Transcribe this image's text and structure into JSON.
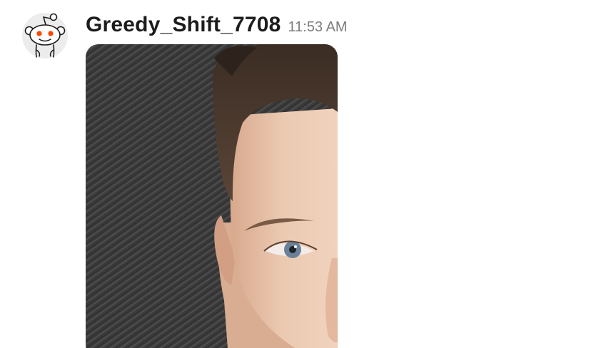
{
  "message": {
    "username": "Greedy_Shift_7708",
    "timestamp": "11:53 AM",
    "avatar_icon": "snoo-avatar-icon",
    "attachment": {
      "type": "image",
      "subject": "photo-thumbnail"
    }
  },
  "colors": {
    "username": "#1c1c1c",
    "timestamp": "#7c7c7c",
    "avatar_background": "#ececec",
    "avatar_eyes": "#ff4500"
  }
}
